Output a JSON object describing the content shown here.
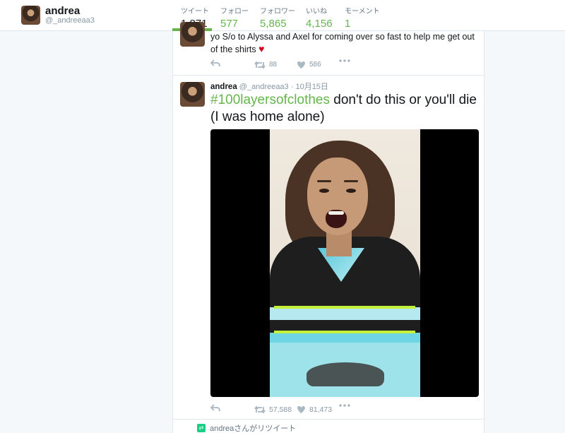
{
  "profile": {
    "name": "andrea",
    "handle": "@_andreeaa3"
  },
  "stats": [
    {
      "label": "ツイート",
      "value": "1,871"
    },
    {
      "label": "フォロー",
      "value": "577"
    },
    {
      "label": "フォロワー",
      "value": "5,865"
    },
    {
      "label": "いいね",
      "value": "4,156"
    },
    {
      "label": "モーメント",
      "value": "1"
    }
  ],
  "tweet1": {
    "text": "yo S/o to Alyssa and Axel for coming over so fast to help me get out of the shirts",
    "emoji": "♥",
    "retweets": "88",
    "likes": "586"
  },
  "tweet2": {
    "name": "andrea",
    "handle": "@_andreeaa3",
    "date": "· 10月15日",
    "hashtag": "#100layersofclothes",
    "text": " don't do this or you'll die (I was home alone)",
    "retweets": "57,588",
    "likes": "81,473"
  },
  "retweet_notice": "andreaさんがリツイート",
  "icons": {
    "reply": "reply-icon",
    "retweet": "retweet-icon",
    "like": "heart-icon",
    "more": "more-icon"
  },
  "colors": {
    "accent": "#66b54c",
    "muted": "#aab8c2"
  }
}
